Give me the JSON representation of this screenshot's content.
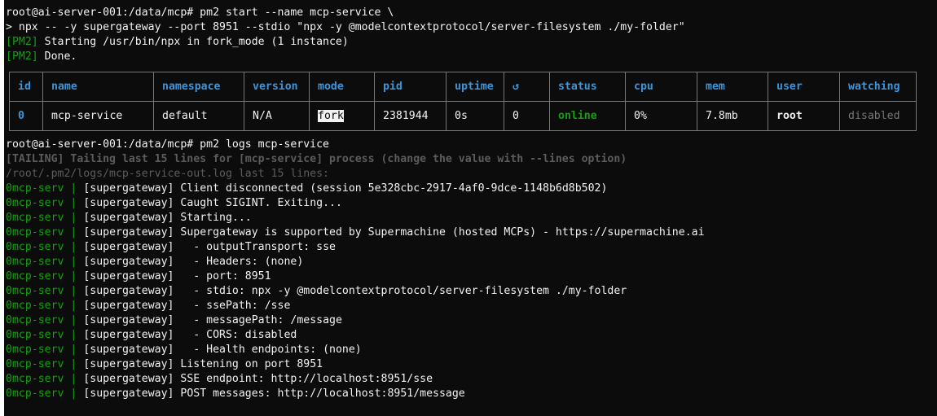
{
  "terminal": {
    "prompt1": "root@ai-server-001:/data/mcp# pm2 start --name mcp-service \\",
    "cont1": "> npx -- -y supergateway --port 8951 --stdio \"npx -y @modelcontextprotocol/server-filesystem ./my-folder\"",
    "pm2_tag": "[PM2]",
    "pm2_start_msg": " Starting /usr/bin/npx in fork_mode (1 instance)",
    "pm2_done_msg": " Done.",
    "prompt2": "root@ai-server-001:/data/mcp# pm2 logs mcp-service",
    "tailing": "[TAILING] Tailing last 15 lines for [mcp-service] process (change the value with --lines option)",
    "logpath": "/root/.pm2/logs/mcp-service-out.log last 15 lines:"
  },
  "table": {
    "headers": {
      "id": "id",
      "name": "name",
      "namespace": "namespace",
      "version": "version",
      "mode": "mode",
      "pid": "pid",
      "uptime": "uptime",
      "restart": "↺",
      "status": "status",
      "cpu": "cpu",
      "mem": "mem",
      "user": "user",
      "watching": "watching"
    },
    "row": {
      "id": "0",
      "name": "mcp-service",
      "namespace": "default",
      "version": "N/A",
      "mode": "fork",
      "pid": "2381944",
      "uptime": "0s",
      "restart": "0",
      "status": "online",
      "cpu": "0%",
      "mem": "7.8mb",
      "user": "root",
      "watching": "disabled"
    }
  },
  "log_prefix": {
    "id": "0",
    "name": "mcp-serv",
    "sep": " | "
  },
  "logs": [
    "[supergateway] Client disconnected (session 5e328cbc-2917-4af0-9dce-1148b6d8b502)",
    "[supergateway] Caught SIGINT. Exiting...",
    "[supergateway] Starting...",
    "[supergateway] Supergateway is supported by Supermachine (hosted MCPs) - https://supermachine.ai",
    "[supergateway]   - outputTransport: sse",
    "[supergateway]   - Headers: (none)",
    "[supergateway]   - port: 8951",
    "[supergateway]   - stdio: npx -y @modelcontextprotocol/server-filesystem ./my-folder",
    "[supergateway]   - ssePath: /sse",
    "[supergateway]   - messagePath: /message",
    "[supergateway]   - CORS: disabled",
    "[supergateway]   - Health endpoints: (none)",
    "[supergateway] Listening on port 8951",
    "[supergateway] SSE endpoint: http://localhost:8951/sse",
    "[supergateway] POST messages: http://localhost:8951/message"
  ],
  "colors": {
    "background": "#0c0c0c",
    "text": "#d4d4d4",
    "green": "#13a10e",
    "blue": "#3a96dd",
    "dim": "#5c5c5c",
    "border": "#767676"
  }
}
